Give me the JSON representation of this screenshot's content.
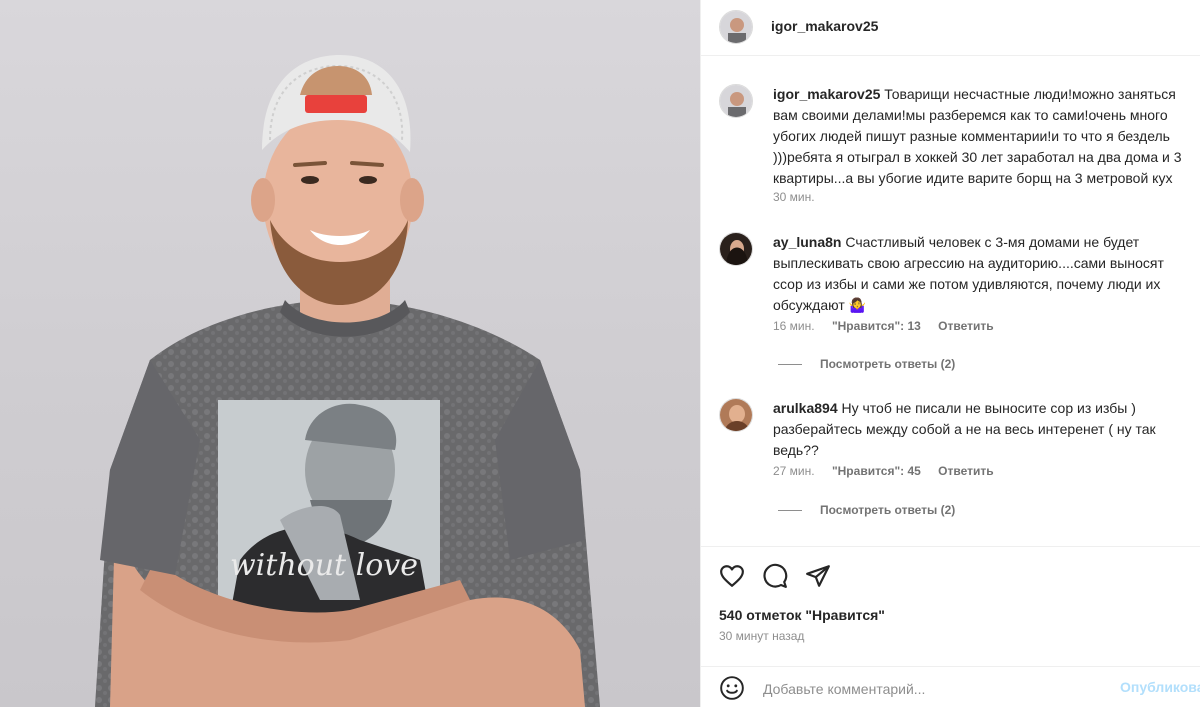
{
  "post": {
    "author": "igor_makarov25",
    "photo_shirt_text": "without love"
  },
  "comments": [
    {
      "username": "igor_makarov25",
      "lines": [
        "Товарищи несчастные люди!можно заняться",
        "вам своими делами!мы разберемся как то сами!очень много",
        "убогих людей пишут разные комментарии!и то что я бездель",
        ")))ребята я отыграл в хоккей 30 лет заработал на два дома и 3",
        "квартиры...а вы убогие идите варите борщ на 3 метровой кух"
      ],
      "time": "30 мин."
    },
    {
      "username": "ay_luna8n",
      "text": "Счастливый человек с 3-мя домами не будет выплескивать свою агрессию на аудиторию....сами выносят ссор из избы и сами же потом удивляются, почему люди их обсуждают 🤷‍♀️",
      "time": "16 мин.",
      "likes": "\"Нравится\": 13",
      "reply": "Ответить",
      "view_replies": "Посмотреть ответы (2)"
    },
    {
      "username": "arulka894",
      "text": "Ну чтоб не писали не выносите сор из избы ) разберайтесь между собой а не на весь интеренет ( ну так ведь??",
      "time": "27 мин.",
      "likes": "\"Нравится\": 45",
      "reply": "Ответить",
      "view_replies": "Посмотреть ответы (2)"
    }
  ],
  "actions": {
    "like_icon": "heart-icon",
    "comment_icon": "comment-bubble-icon",
    "share_icon": "paper-plane-icon"
  },
  "stats": {
    "likes": "540 отметок \"Нравится\"",
    "posted": "30 минут назад"
  },
  "add_comment": {
    "emoji_icon": "smiley-icon",
    "placeholder": "Добавьте комментарий...",
    "publish": "Опубликовать"
  },
  "colors": {
    "accent": "#0095f6",
    "publish_disabled": "#b2dffc",
    "secondary_text": "#8e8e8e"
  }
}
